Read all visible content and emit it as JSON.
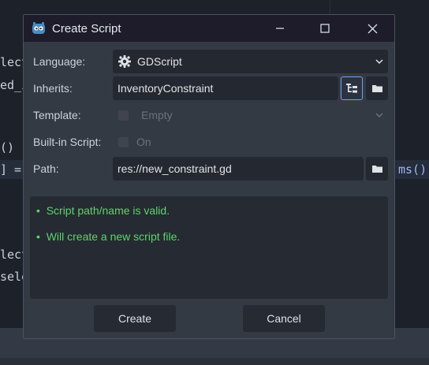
{
  "background": {
    "code_lines": [
      "lect",
      "ed_i",
      "() -",
      "] =",
      "lect",
      "sele",
      "ms()"
    ]
  },
  "dialog": {
    "title": "Create Script",
    "fields": {
      "language": {
        "label": "Language:",
        "value": "GDScript"
      },
      "inherits": {
        "label": "Inherits:",
        "value": "InventoryConstraint"
      },
      "template": {
        "label": "Template:",
        "value": "Empty"
      },
      "builtin": {
        "label": "Built-in Script:",
        "value": "On"
      },
      "path": {
        "label": "Path:",
        "value": "res://new_constraint.gd"
      }
    },
    "messages": [
      "Script path/name is valid.",
      "Will create a new script file."
    ],
    "buttons": {
      "create": "Create",
      "cancel": "Cancel"
    }
  },
  "colors": {
    "titlebar": "#1e1b2a",
    "dialog": "#343a44",
    "field": "#242830",
    "valid_text": "#5bd46c",
    "accent": "#6da3ef"
  },
  "icons": [
    "godot-icon",
    "minimize-icon",
    "maximize-icon",
    "close-icon",
    "gear-icon",
    "chevron-down-icon",
    "class-tree-icon",
    "folder-icon"
  ]
}
